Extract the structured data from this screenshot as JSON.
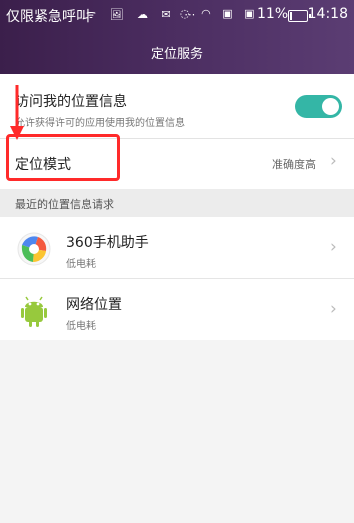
{
  "status_bar": {
    "carrier": "仅限紧急呼叫",
    "left_icons": "ᯤ 🖼 ☁ ✉ ⋯",
    "right_icons": "◌ ◠ ▣ ▣",
    "battery_percent": "11%",
    "battery_level": 0.11,
    "time": "14:18"
  },
  "header": {
    "title": "定位服务"
  },
  "settings": {
    "access_location": {
      "title": "访问我的位置信息",
      "subtitle": "允许获得许可的应用使用我的位置信息",
      "enabled": true
    },
    "location_mode": {
      "title": "定位模式",
      "value": "准确度高",
      "chevron": "›"
    }
  },
  "recent_requests": {
    "header": "最近的位置信息请求",
    "items": [
      {
        "name": "360手机助手",
        "subtitle": "低电耗",
        "chevron": "›"
      },
      {
        "name": "网络位置",
        "subtitle": "低电耗",
        "chevron": "›"
      }
    ]
  },
  "colors": {
    "header_background": "#4a2c5f",
    "toggle_on": "#34b6a6",
    "annotation_red": "#ff2a2a"
  }
}
